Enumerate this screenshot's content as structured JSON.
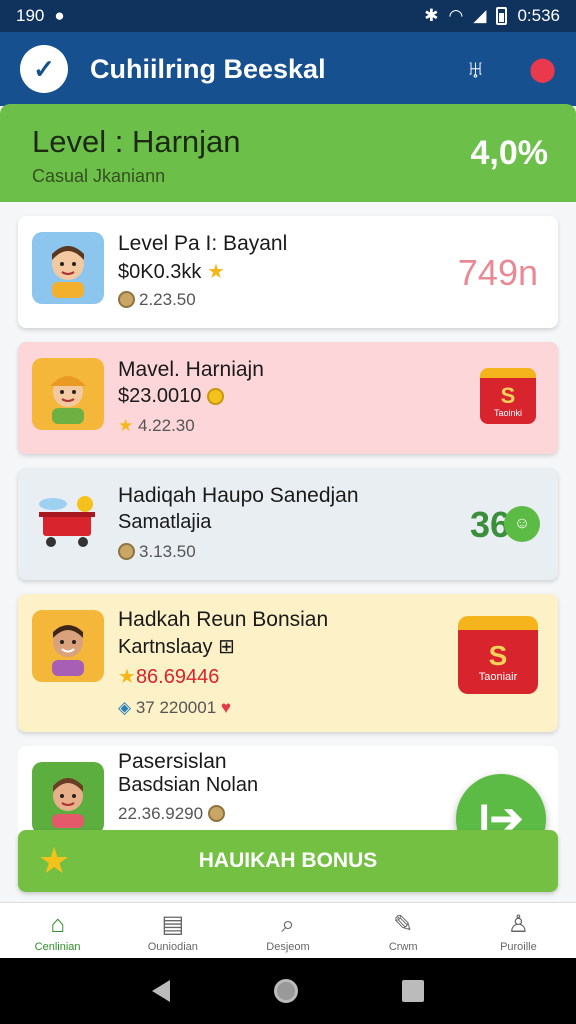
{
  "status_bar": {
    "time": "190",
    "clock": "0:536"
  },
  "app": {
    "title": "Cuhiilring Beeskal"
  },
  "level_banner": {
    "name": "Level : Harnjan",
    "subtitle": "Casual Jkaniann",
    "percent": "4,0%"
  },
  "cards": [
    {
      "title": "Level Pa I: Bayanl",
      "amount": "$0K0.3kk",
      "stat": "2.23.50",
      "reward": "749n",
      "bg": "#ffffff",
      "reward_color": "#e88a95"
    },
    {
      "title": "Mavel. Harniajn",
      "amount": "$23.0010",
      "stat": "4.22.30",
      "gift_letter": "S",
      "gift_label": "Taoinki",
      "bg": "#fcd6d8"
    },
    {
      "title": "Hadiqah Haupo Sanedjan",
      "amount": "Samatlajia",
      "stat": "3.13.50",
      "reward": "36",
      "bg": "#e9eef2",
      "reward_color": "#3b8f3b"
    },
    {
      "title": "Hadkah Reun Bonsian",
      "amount": "Kartnslaay",
      "amount2": "86.69446",
      "stat": "37 220001",
      "gift_letter": "S",
      "gift_label": "Taoniair",
      "bg": "#fdf1c7"
    },
    {
      "title": "Pasersislan",
      "amount": "Basdsian Nolan",
      "stat": "22.36.9290",
      "bg": "#ffffff"
    }
  ],
  "bonus_button": {
    "label": "HAUIKAH BONUS"
  },
  "fab": {
    "label": "I➔"
  },
  "nav": [
    {
      "label": "Cenlinian",
      "icon": "home-icon",
      "glyph": "⌂"
    },
    {
      "label": "Ouniodian",
      "icon": "list-icon",
      "glyph": "▤"
    },
    {
      "label": "Desjeom",
      "icon": "search-icon",
      "glyph": "⌕"
    },
    {
      "label": "Crwm",
      "icon": "edit-icon",
      "glyph": "✎"
    },
    {
      "label": "Puroille",
      "icon": "profile-icon",
      "glyph": "♙"
    }
  ],
  "colors": {
    "primary": "#17508f",
    "accent_green": "#6cc04a",
    "status_bar": "#10335e"
  }
}
